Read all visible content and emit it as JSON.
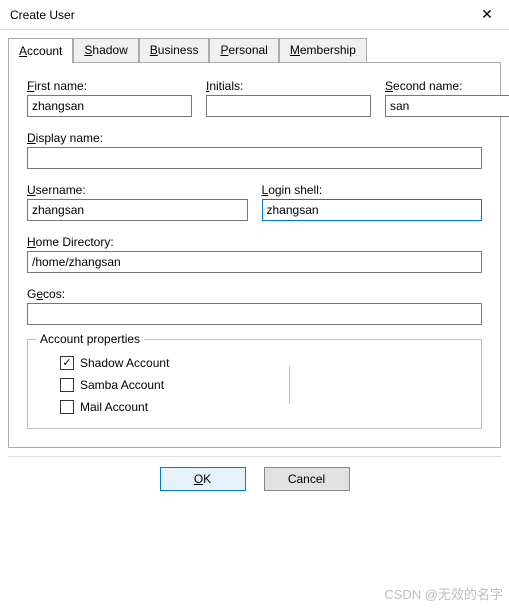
{
  "window": {
    "title": "Create User"
  },
  "tabs": [
    {
      "label_pre": "",
      "label_u": "A",
      "label_post": "ccount",
      "active": true
    },
    {
      "label_pre": "",
      "label_u": "S",
      "label_post": "hadow",
      "active": false
    },
    {
      "label_pre": "",
      "label_u": "B",
      "label_post": "usiness",
      "active": false
    },
    {
      "label_pre": "",
      "label_u": "P",
      "label_post": "ersonal",
      "active": false
    },
    {
      "label_pre": "",
      "label_u": "M",
      "label_post": "embership",
      "active": false
    }
  ],
  "fields": {
    "first_name": {
      "label_u": "F",
      "label_post": "irst name:",
      "value": "zhangsan"
    },
    "initials": {
      "label_u": "I",
      "label_post": "nitials:",
      "value": ""
    },
    "second_name": {
      "label_u": "S",
      "label_post": "econd name:",
      "value": "san"
    },
    "display_name": {
      "label_u": "D",
      "label_post": "isplay name:",
      "value": ""
    },
    "username": {
      "label_u": "U",
      "label_post": "sername:",
      "value": "zhangsan"
    },
    "login_shell": {
      "label_u": "L",
      "label_post": "ogin shell:",
      "value": "zhangsan"
    },
    "home_dir": {
      "label_u": "H",
      "label_post": "ome Directory:",
      "value": "/home/zhangsan"
    },
    "gecos": {
      "label_pre": "G",
      "label_u": "e",
      "label_post": "cos:",
      "value": ""
    }
  },
  "groupbox": {
    "legend": "Account properties",
    "items": [
      {
        "label": "Shadow Account",
        "checked": true
      },
      {
        "label": "Samba Account",
        "checked": false
      },
      {
        "label": "Mail Account",
        "checked": false
      }
    ]
  },
  "buttons": {
    "ok_u": "O",
    "ok_post": "K",
    "cancel": "Cancel"
  },
  "watermark": "CSDN @无效的名字",
  "glyphs": {
    "check": "✓",
    "close": "✕"
  }
}
